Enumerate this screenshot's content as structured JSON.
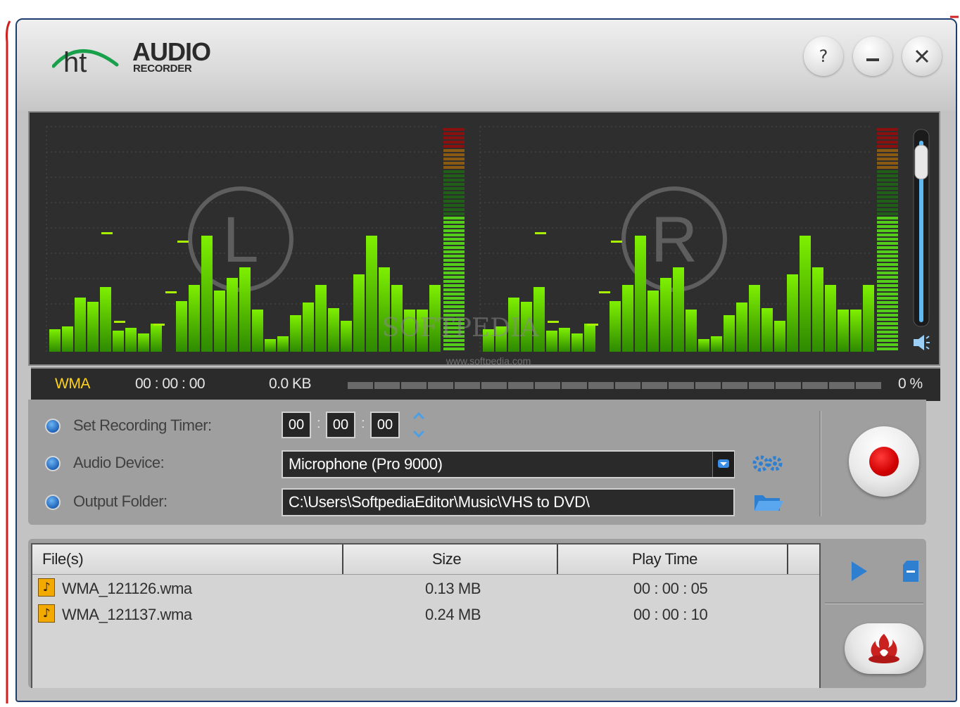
{
  "app": {
    "logo_ht": "ht",
    "logo_audio": "AUDIO",
    "logo_recorder": "RECORDER",
    "help_label": "?"
  },
  "meter": {
    "left_channel": "L",
    "right_channel": "R",
    "watermark": "SOFTPEDIA",
    "watermark_url": "www.softpedia.com",
    "volume_level": 0.95
  },
  "status": {
    "format": "WMA",
    "elapsed": "00 : 00 : 00",
    "size": "0.0 KB",
    "percent": "0 %",
    "progress": 0
  },
  "controls": {
    "timer_label": "Set Recording Timer:",
    "timer_hh": "00",
    "timer_mm": "00",
    "timer_ss": "00",
    "device_label": "Audio Device:",
    "device_value": "Microphone (Pro 9000)",
    "folder_label": "Output Folder:",
    "folder_value": "C:\\Users\\SoftpediaEditor\\Music\\VHS to DVD\\"
  },
  "files": {
    "columns": [
      "File(s)",
      "Size",
      "Play Time"
    ],
    "rows": [
      {
        "name": "WMA_121126.wma",
        "size": "0.13 MB",
        "time": "00 : 00 : 05"
      },
      {
        "name": "WMA_121137.wma",
        "size": "0.24 MB",
        "time": "00 : 00 : 10"
      }
    ]
  },
  "colors": {
    "accent_blue": "#1e63b8",
    "record_red": "#d00000",
    "meter_green": "#58d200",
    "format_yellow": "#ffd21e"
  }
}
